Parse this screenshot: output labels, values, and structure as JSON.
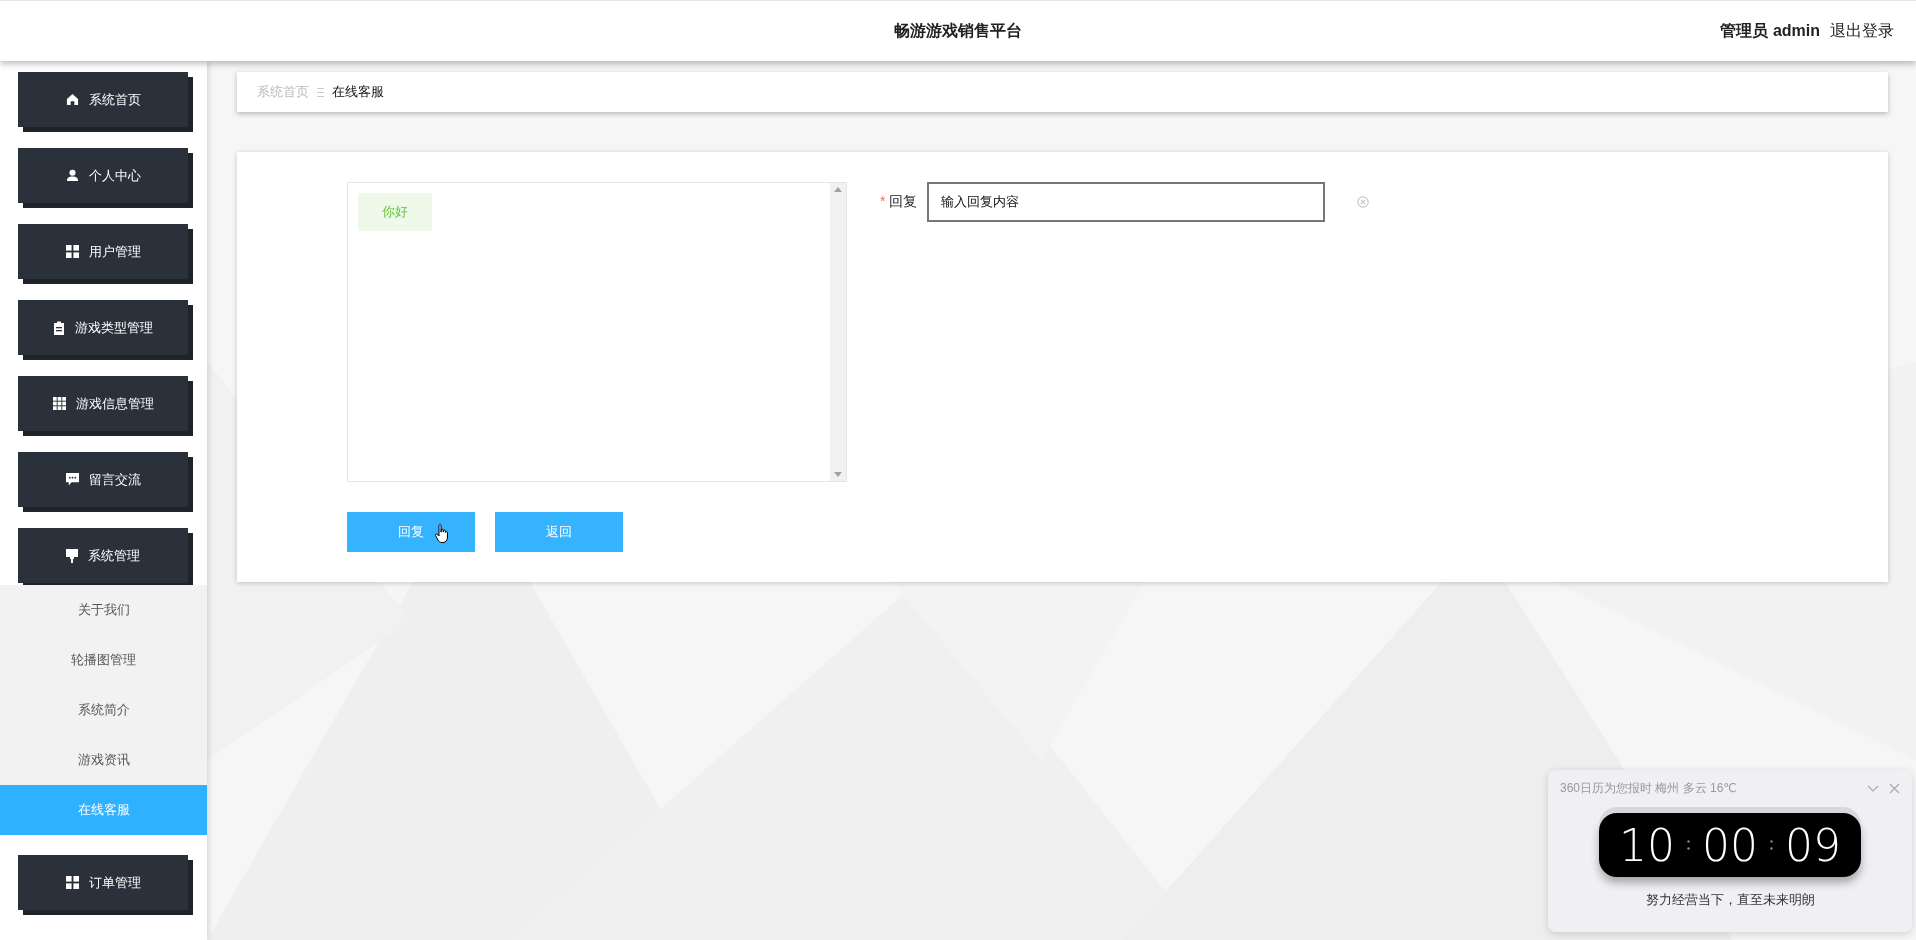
{
  "header": {
    "title": "畅游游戏销售平台",
    "user_role": "管理员",
    "username": "admin",
    "logout": "退出登录"
  },
  "sidebar": {
    "items": [
      {
        "label": "系统首页"
      },
      {
        "label": "个人中心"
      },
      {
        "label": "用户管理"
      },
      {
        "label": "游戏类型管理"
      },
      {
        "label": "游戏信息管理"
      },
      {
        "label": "留言交流"
      },
      {
        "label": "系统管理",
        "children": [
          {
            "label": "关于我们",
            "selected": false
          },
          {
            "label": "轮播图管理",
            "selected": false
          },
          {
            "label": "系统简介",
            "selected": false
          },
          {
            "label": "游戏资讯",
            "selected": false
          },
          {
            "label": "在线客服",
            "selected": true
          }
        ]
      },
      {
        "label": "订单管理"
      }
    ]
  },
  "breadcrumb": [
    "系统首页",
    "在线客服"
  ],
  "chat": {
    "messages": [
      {
        "text": "你好"
      }
    ]
  },
  "reply_form": {
    "required_mark": "*",
    "label": "回复",
    "value": "输入回复内容"
  },
  "buttons": [
    "回复",
    "返回"
  ],
  "clock_widget": {
    "title": "360日历为您报时 梅州 多云 16℃",
    "time": [
      "10",
      "00",
      "09"
    ],
    "motto": "努力经营当下，直至未来明朗"
  }
}
